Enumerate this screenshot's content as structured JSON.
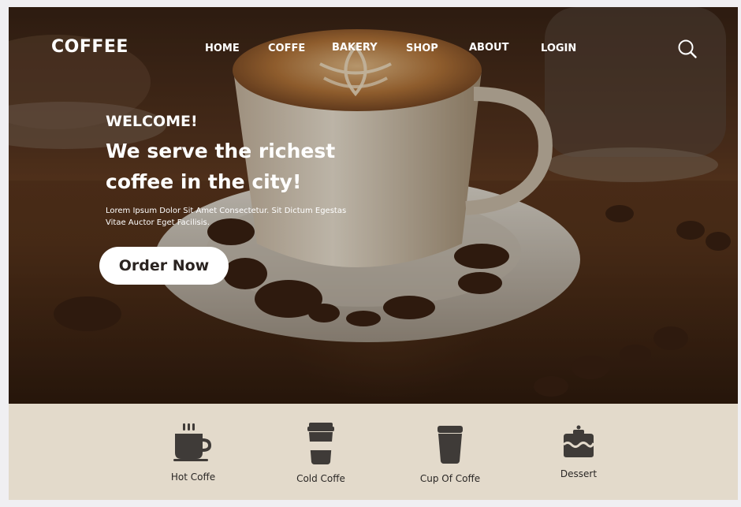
{
  "nav": {
    "logo": "COFFEE",
    "items": [
      {
        "label": "HOME"
      },
      {
        "label": "COFFE"
      },
      {
        "label": "BAKERY"
      },
      {
        "label": "SHOP"
      },
      {
        "label": "ABOUT"
      },
      {
        "label": "LOGIN"
      }
    ],
    "search_icon": "search-icon"
  },
  "hero": {
    "welcome": "WELCOME!",
    "headline": "We serve the richest coffee in the city!",
    "description": "Lorem Ipsum Dolor Sit Amet Consectetur. Sit Dictum Egestas Vitae Auctor Eget Facilisis.",
    "cta_label": "Order Now"
  },
  "categories": [
    {
      "label": "Hot Coffe",
      "icon": "hot-coffee-icon"
    },
    {
      "label": "Cold Coffe",
      "icon": "cold-coffee-cup-icon"
    },
    {
      "label": "Cup Of Coffe",
      "icon": "coffee-cup-icon"
    },
    {
      "label": "Dessert",
      "icon": "cake-icon"
    }
  ],
  "colors": {
    "category_bar": "#e3dacb",
    "icon": "#3f3b38",
    "button_bg": "#ffffff",
    "text_light": "#ffffff"
  }
}
